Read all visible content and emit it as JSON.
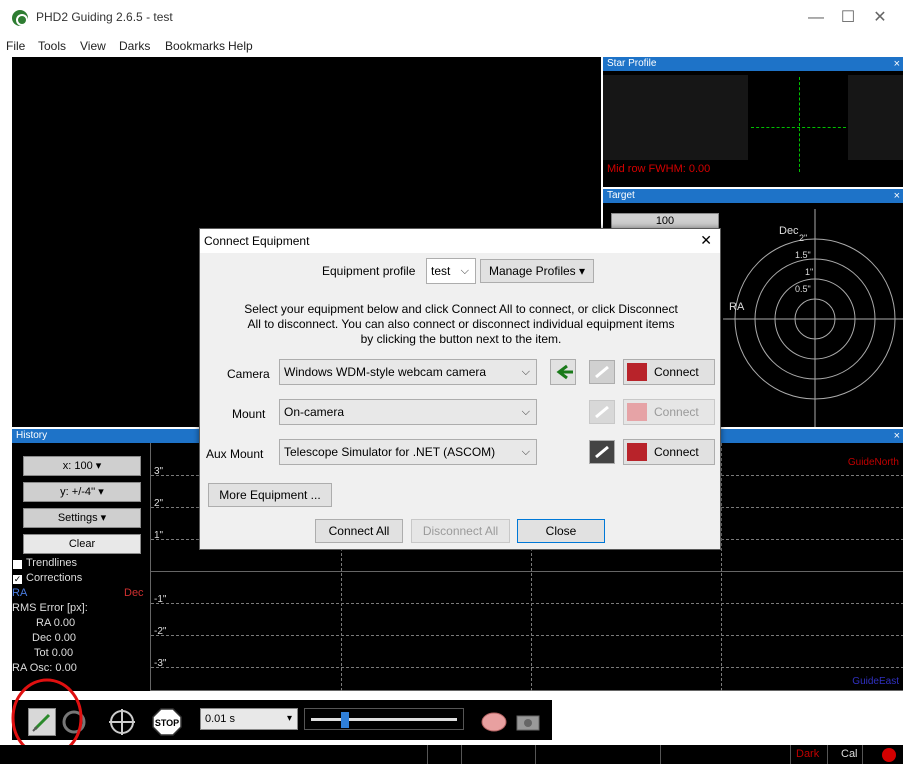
{
  "window": {
    "title": "PHD2 Guiding 2.6.5 - test",
    "minimize": "—",
    "maximize": "☐",
    "close": "✕"
  },
  "menu": [
    "File",
    "Tools",
    "View",
    "Darks",
    "Bookmarks",
    "Help"
  ],
  "star_profile": {
    "title": "Star Profile",
    "close": "×",
    "fwhm": "Mid row FWHM: 0.00"
  },
  "target": {
    "title": "Target",
    "close": "×",
    "scale_value": "100",
    "dec_label": "Dec",
    "ra_label": "RA",
    "rings": [
      "2\"",
      "1.5\"",
      "1\"",
      "0.5\""
    ]
  },
  "history": {
    "title": "History",
    "close": "×",
    "x_scale": "x: 100",
    "y_scale": "y: +/-4''",
    "settings": "Settings",
    "clear": "Clear",
    "trendlines": "Trendlines",
    "corrections": "Corrections",
    "ra": "RA",
    "dec": "Dec",
    "rms_error": "RMS Error [px]:",
    "ra_val": "RA 0.00",
    "dec_val": "Dec 0.00",
    "tot_val": "Tot 0.00",
    "ra_osc": "RA Osc: 0.00",
    "y_ticks": [
      "3\"",
      "2\"",
      "1\"",
      "-1\"",
      "-2\"",
      "-3\""
    ],
    "guide_north": "GuideNorth",
    "guide_east": "GuideEast"
  },
  "toolbar": {
    "exposure": "0.01 s",
    "stop": "STOP"
  },
  "status": {
    "dark": "Dark",
    "cal": "Cal"
  },
  "dialog": {
    "title": "Connect Equipment",
    "close": "✕",
    "profile_label": "Equipment profile",
    "profile_value": "test",
    "manage_profiles": "Manage Profiles",
    "instructions_1": "Select your equipment below and click Connect All to connect, or click Disconnect",
    "instructions_2": "All to disconnect. You can also connect or disconnect individual equipment items",
    "instructions_3": "by clicking the button next to the item.",
    "camera_label": "Camera",
    "camera_value": "Windows WDM-style webcam camera",
    "mount_label": "Mount",
    "mount_value": "On-camera",
    "aux_label": "Aux Mount",
    "aux_value": "Telescope Simulator for .NET (ASCOM)",
    "connect": "Connect",
    "more_equipment": "More Equipment ...",
    "connect_all": "Connect All",
    "disconnect_all": "Disconnect All",
    "close_btn": "Close"
  },
  "colors": {
    "panel_header": "#1e73c8",
    "fwhm_red": "#d40000",
    "crosshair_green": "#00c000",
    "north_red": "#c00000",
    "east_blue": "#3030c0",
    "highlight_circle": "#e01010"
  }
}
